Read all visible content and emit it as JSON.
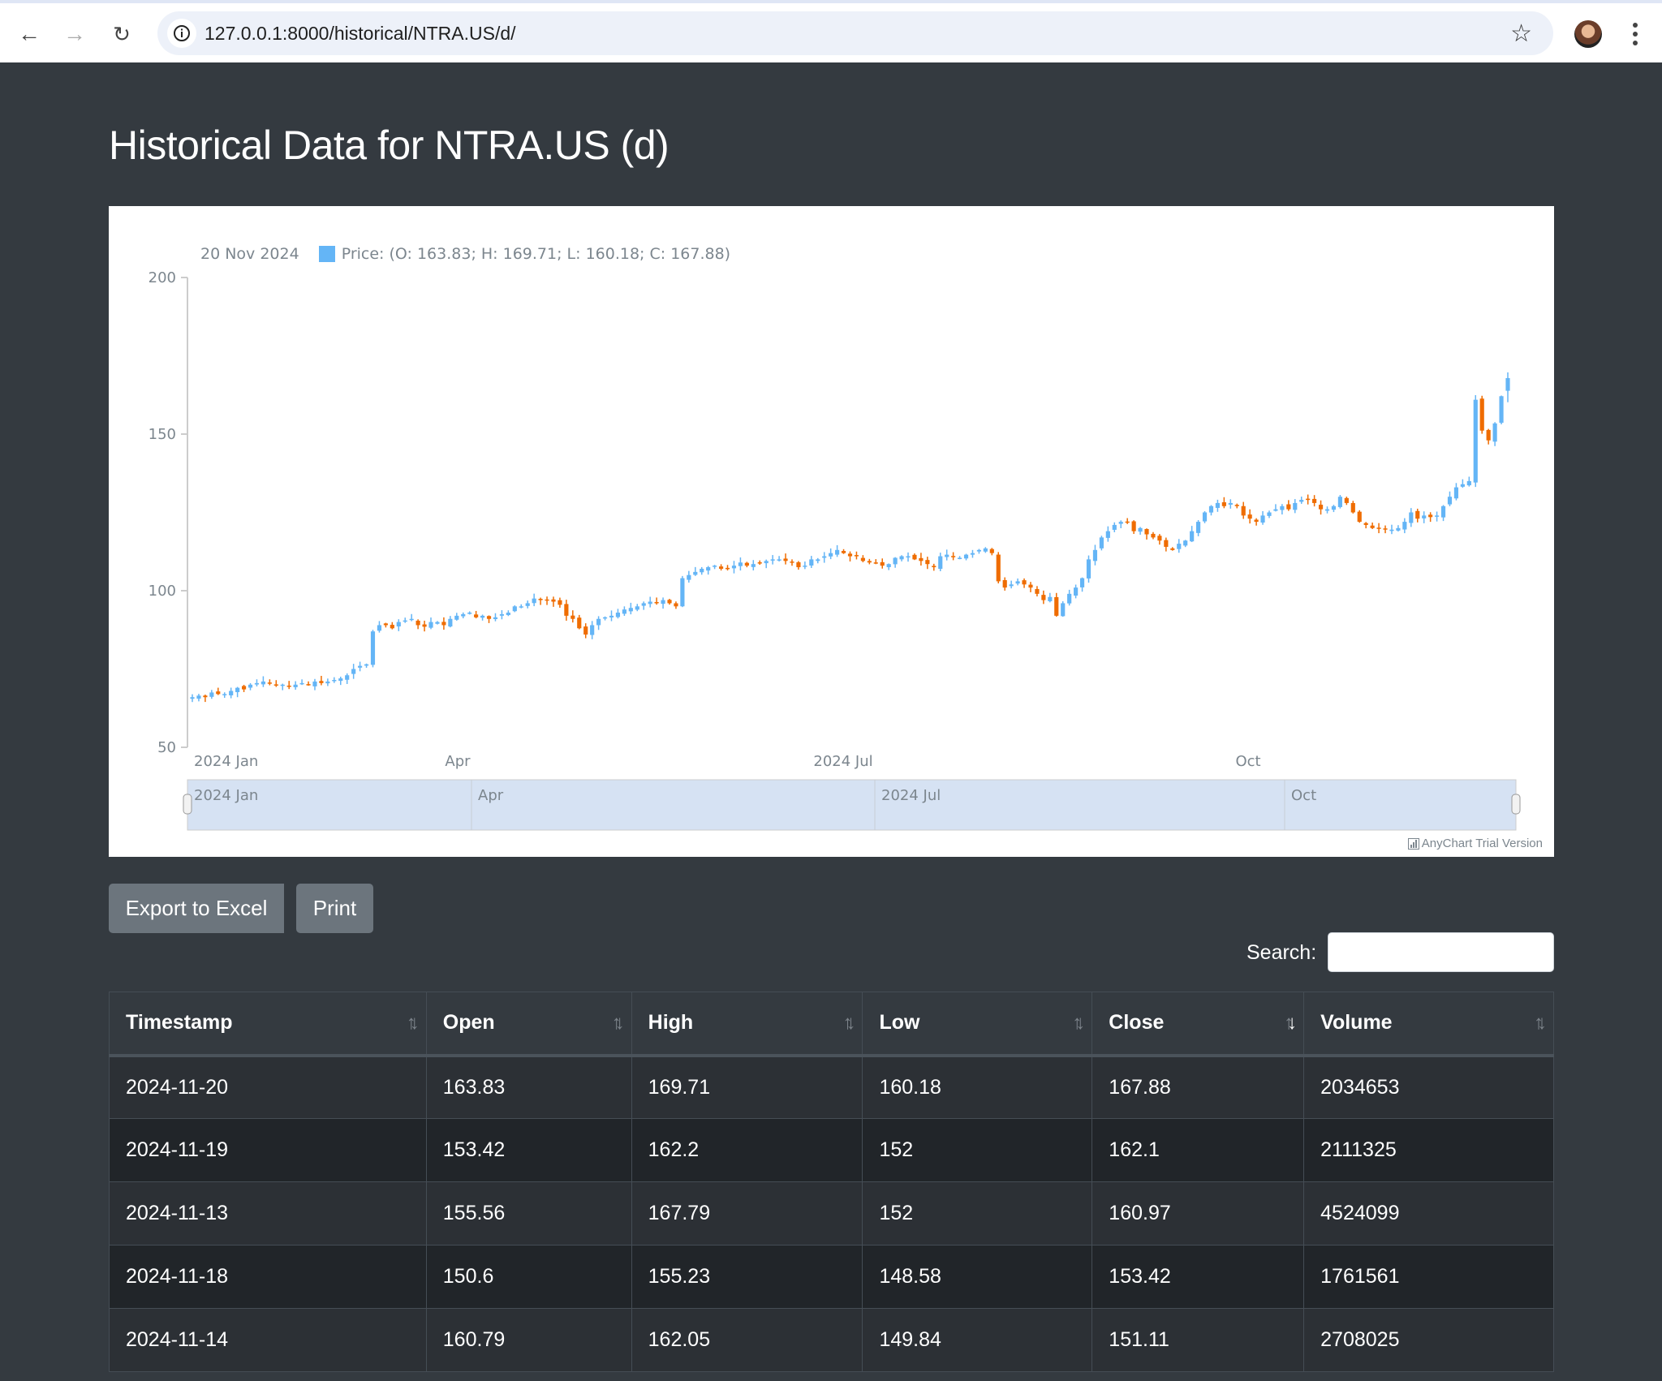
{
  "browser": {
    "url": "127.0.0.1:8000/historical/NTRA.US/d/",
    "back_icon": "arrow-left-icon",
    "forward_icon": "arrow-right-icon",
    "reload_icon": "reload-icon",
    "info_icon": "info-icon",
    "bookmark_icon": "star-icon",
    "menu_icon": "kebab-menu-icon"
  },
  "page": {
    "title": "Historical Data for NTRA.US (d)"
  },
  "chart_legend": {
    "date": "20 Nov 2024",
    "series_text": "Price: (O: 163.83; H: 169.71; L: 160.18; C: 167.88)"
  },
  "watermark": "AnyChart Trial Version",
  "buttons": {
    "export": "Export to Excel",
    "print": "Print"
  },
  "search": {
    "label": "Search:",
    "value": "",
    "placeholder": ""
  },
  "table": {
    "sorted_column": "Close",
    "sort_direction": "desc",
    "columns": [
      "Timestamp",
      "Open",
      "High",
      "Low",
      "Close",
      "Volume"
    ],
    "rows": [
      [
        "2024-11-20",
        "163.83",
        "169.71",
        "160.18",
        "167.88",
        "2034653"
      ],
      [
        "2024-11-19",
        "153.42",
        "162.2",
        "152",
        "162.1",
        "2111325"
      ],
      [
        "2024-11-13",
        "155.56",
        "167.79",
        "152",
        "160.97",
        "4524099"
      ],
      [
        "2024-11-18",
        "150.6",
        "155.23",
        "148.58",
        "153.42",
        "1761561"
      ],
      [
        "2024-11-14",
        "160.79",
        "162.05",
        "149.84",
        "151.11",
        "2708025"
      ]
    ]
  },
  "colors": {
    "rising": "#64b5f6",
    "falling": "#ef6c00",
    "page_bg": "#343a40",
    "navigator_fill": "#d6e2f3"
  },
  "chart_data": {
    "type": "candlestick",
    "title": "",
    "series_name": "Price",
    "ylim": [
      50,
      200
    ],
    "yticks": [
      50,
      100,
      150,
      200
    ],
    "x_range": [
      "2024-01-02",
      "2024-11-20"
    ],
    "xticks": [
      "2024 Jan",
      "Apr",
      "2024 Jul",
      "Oct"
    ],
    "navigator_ticks": [
      "2024 Jan",
      "Apr",
      "2024 Jul",
      "Oct"
    ],
    "grid": false,
    "legend_position": "top-left",
    "approx_closes": [
      66,
      66.5,
      66,
      67.5,
      67,
      67,
      68,
      69,
      68.5,
      70,
      70.5,
      71,
      70.5,
      70,
      70,
      69.5,
      70,
      70.5,
      70,
      71,
      70.5,
      71,
      71.5,
      72,
      73,
      75,
      76,
      76.5,
      87,
      89,
      89,
      88,
      90,
      90.5,
      91,
      89,
      88.5,
      90,
      90,
      89,
      91,
      92,
      92.5,
      93,
      91.5,
      92,
      91,
      91.5,
      92.5,
      93,
      95,
      95,
      96,
      97.5,
      97,
      97,
      96.5,
      95.5,
      92,
      91,
      88,
      86,
      89,
      91,
      91.5,
      92,
      93,
      94,
      94.5,
      95,
      96,
      96.5,
      96,
      97,
      96,
      95,
      104,
      105,
      106,
      107,
      107.5,
      108,
      107,
      107,
      108,
      109,
      108,
      108.5,
      109,
      109.5,
      110,
      110,
      109.5,
      109,
      107.5,
      108,
      110,
      110,
      111,
      112,
      113,
      112,
      111,
      111,
      109.5,
      109,
      109,
      108,
      108.5,
      110.5,
      111,
      111,
      110,
      109.5,
      108.5,
      107.5,
      111,
      111.5,
      111,
      110.5,
      111.5,
      112,
      113,
      113.5,
      112,
      103,
      101,
      102,
      103,
      102,
      101,
      99,
      97,
      98,
      92,
      96,
      99,
      101,
      104,
      110,
      113,
      117,
      119,
      121,
      122,
      122,
      119,
      120,
      118,
      117,
      116,
      114,
      113,
      115,
      116,
      119,
      122,
      125,
      127,
      128,
      127,
      128,
      127,
      124,
      123,
      122,
      124,
      125,
      126,
      127,
      126,
      128,
      129,
      129,
      128,
      126,
      126,
      127,
      130,
      128,
      125,
      122,
      121,
      120,
      120,
      119.5,
      119.5,
      120,
      122,
      125,
      123,
      124,
      123.5,
      124,
      127,
      130,
      133,
      134,
      135,
      160.97,
      151.11,
      148,
      153.42,
      162.1,
      167.88
    ],
    "last_point": {
      "date": "2024-11-20",
      "open": 163.83,
      "high": 169.71,
      "low": 160.18,
      "close": 167.88
    }
  }
}
